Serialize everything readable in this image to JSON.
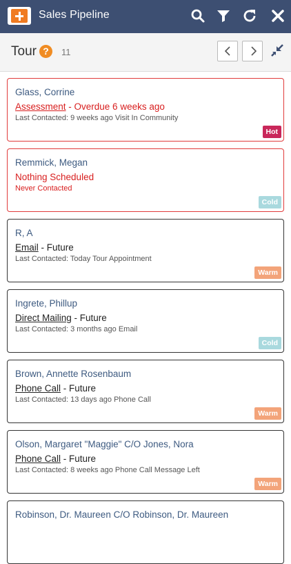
{
  "header": {
    "title": "Sales Pipeline",
    "icons": [
      "plus-icon",
      "search-icon",
      "filter-icon",
      "refresh-icon",
      "close-icon"
    ],
    "accent_color": "#f07b21",
    "bar_color": "#3d4f72"
  },
  "subheader": {
    "label": "Tour",
    "help_icon": "?",
    "count": "11"
  },
  "cards": [
    {
      "name": "Glass, Corrine",
      "activity_type": "Assessment",
      "activity_status": " - Overdue 6 weeks ago",
      "last_contacted": "Last Contacted: 9 weeks ago Visit In Community",
      "tag": "Hot"
    },
    {
      "name": "Remmick, Megan",
      "activity_type": "",
      "activity_status": "Nothing Scheduled",
      "last_contacted": "Never Contacted",
      "tag": "Cold"
    },
    {
      "name": "R, A",
      "activity_type": "Email",
      "activity_status": " - Future",
      "last_contacted": "Last Contacted: Today Tour Appointment",
      "tag": "Warm"
    },
    {
      "name": "Ingrete, Phillup",
      "activity_type": "Direct Mailing",
      "activity_status": " - Future",
      "last_contacted": "Last Contacted: 3 months ago Email",
      "tag": "Cold"
    },
    {
      "name": "Brown, Annette Rosenbaum",
      "activity_type": "Phone Call",
      "activity_status": " - Future",
      "last_contacted": "Last Contacted: 13 days ago Phone Call",
      "tag": "Warm"
    },
    {
      "name": "Olson, Margaret \"Maggie\" C/O Jones, Nora",
      "activity_type": "Phone Call",
      "activity_status": " - Future",
      "last_contacted": "Last Contacted: 8 weeks ago Phone Call Message Left",
      "tag": "Warm"
    },
    {
      "name": "Robinson, Dr. Maureen C/O Robinson, Dr. Maureen"
    }
  ]
}
